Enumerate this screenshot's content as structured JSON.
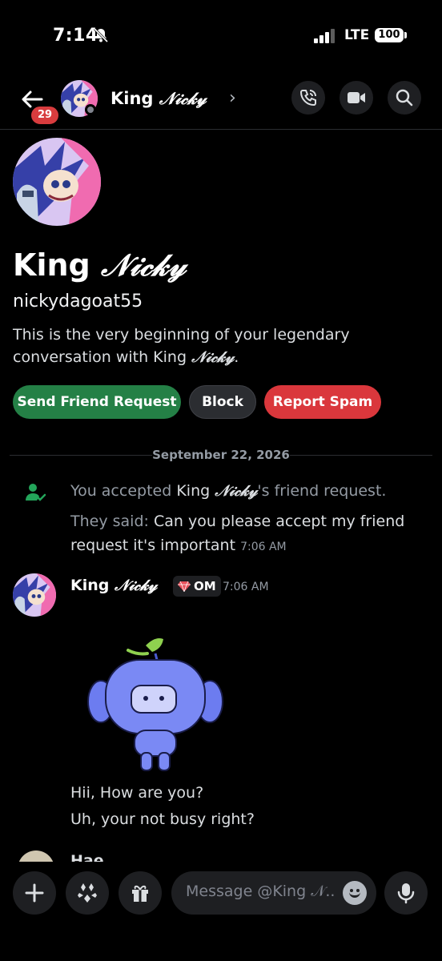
{
  "status_bar": {
    "time": "7:14",
    "network": "LTE",
    "battery": "100"
  },
  "header": {
    "back_badge": "29",
    "title_plain": "King ",
    "title_fancy": "𝒩𝒾𝒸𝓀𝓎",
    "chevron": "›"
  },
  "profile": {
    "name_plain": "King ",
    "name_fancy": "𝒩𝒾𝒸𝓀𝓎",
    "username": "nickydagoat55",
    "intro_prefix": "This is the very beginning of your legendary conversation with King ",
    "intro_fancy": "𝒩𝒾𝒸𝓀𝓎",
    "intro_suffix": "."
  },
  "actions": {
    "send_friend_request": "Send Friend Request",
    "block": "Block",
    "report_spam": "Report Spam"
  },
  "date_divider": "September 22, 2026",
  "system_message": {
    "prefix": "You accepted ",
    "name_plain": "King ",
    "name_fancy": "𝒩𝒾𝒸𝓀𝓎",
    "suffix": "'s friend request.",
    "said_label": "They said: ",
    "said_text": "Can you please accept my friend request it's important",
    "timestamp": "7:06 AM"
  },
  "message": {
    "author_plain": "King ",
    "author_fancy": "𝒩𝒾𝒸𝓀𝓎",
    "tag": "OM",
    "timestamp": "7:06 AM",
    "line1": "Hii, How are you?",
    "line2": "Uh, your not busy right?"
  },
  "next_message_peek": "Hae",
  "composer": {
    "placeholder": "Message @King 𝒩.."
  },
  "colors": {
    "green": "#248046",
    "red": "#da373c",
    "blurple": "#5865f2",
    "badge_red": "#d83c3e"
  }
}
